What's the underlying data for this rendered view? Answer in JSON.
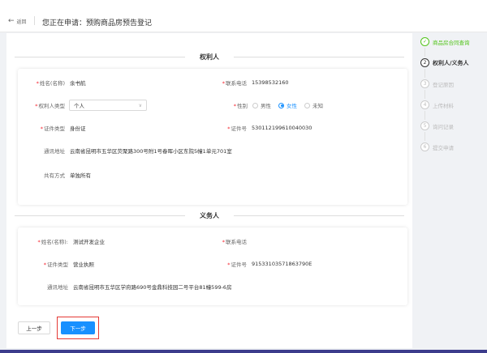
{
  "header": {
    "back_label": "返回",
    "title": "您正在申请：预购商品房预告登记"
  },
  "rights_holder": {
    "section_title": "权利人",
    "name_label": "姓名(名称)",
    "name_value": "余书航",
    "phone_label": "联系电话",
    "phone_value": "15398532160",
    "type_label": "权利人类型",
    "type_value": "个人",
    "gender_label": "性别",
    "gender_options": [
      "男性",
      "女性",
      "未知"
    ],
    "gender_selected": "女性",
    "id_type_label": "证件类型",
    "id_type_value": "身份证",
    "id_no_label": "证件号",
    "id_no_value": "530112199610040030",
    "address_label": "通讯地址",
    "address_value": "云南省昆明市五华区荧聚路300号附1号春晖小区东院5幢1单元701室",
    "share_label": "共有方式",
    "share_value": "单独所有"
  },
  "obligor": {
    "section_title": "义务人",
    "name_label": "姓名(名称):",
    "name_value": "测试开发企业",
    "phone_label": "联系电话",
    "phone_value": "",
    "id_type_label": "证件类型",
    "id_type_value": "营业执照",
    "id_no_label": "证件号",
    "id_no_value": "91533103571863790E",
    "address_label": "通讯地址",
    "address_value": "云南省昆明市五华区学府路690号金鼎科技园二号平台81幢599-6房"
  },
  "actions": {
    "prev_label": "上一步",
    "next_label": "下一步"
  },
  "steps": [
    {
      "num": "✓",
      "label": "商品房合同查询",
      "state": "done"
    },
    {
      "num": "2",
      "label": "权利人/义务人",
      "state": "active"
    },
    {
      "num": "3",
      "label": "登记原因",
      "state": "pending"
    },
    {
      "num": "4",
      "label": "上传材料",
      "state": "pending"
    },
    {
      "num": "5",
      "label": "询问记录",
      "state": "pending"
    },
    {
      "num": "6",
      "label": "提交申请",
      "state": "pending"
    }
  ],
  "colors": {
    "primary": "#1890ff",
    "success": "#52c41a",
    "required": "#f5222d",
    "highlight_box": "#e53935"
  }
}
